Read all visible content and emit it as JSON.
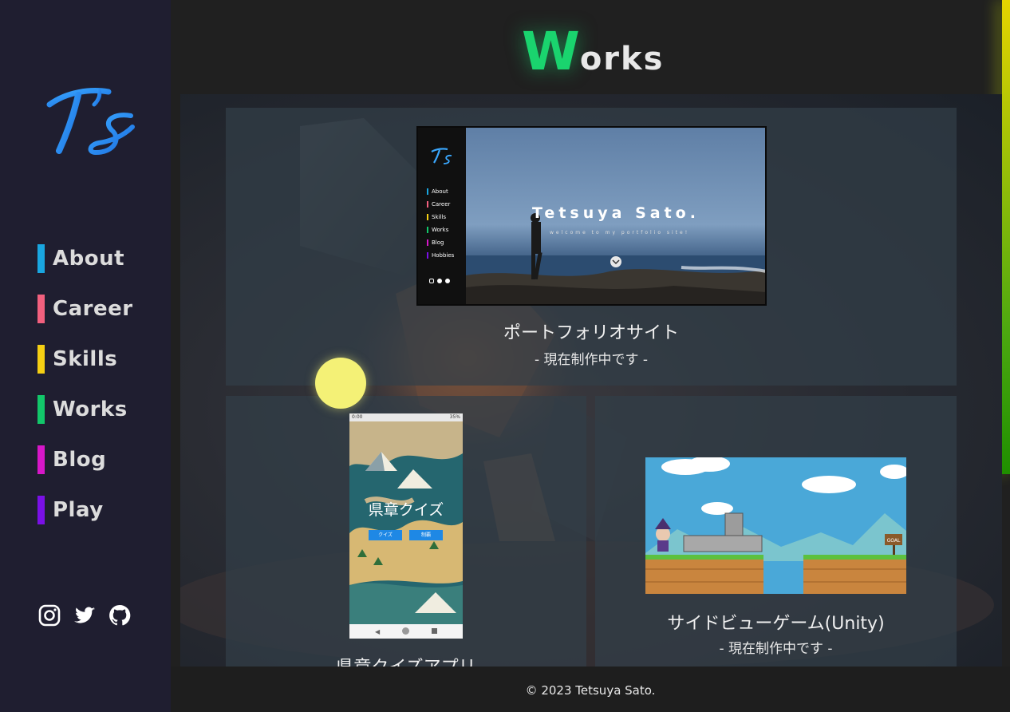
{
  "sidebar": {
    "nav": [
      {
        "label": "About",
        "color": "#19a6e0"
      },
      {
        "label": "Career",
        "color": "#f2607e"
      },
      {
        "label": "Skills",
        "color": "#f5cf13"
      },
      {
        "label": "Works",
        "color": "#12c76a"
      },
      {
        "label": "Blog",
        "color": "#d717c9"
      },
      {
        "label": "Play",
        "color": "#7a10e6"
      }
    ],
    "social_icons": [
      "instagram-icon",
      "twitter-icon",
      "github-icon"
    ]
  },
  "header": {
    "title_first": "W",
    "title_rest": "orks"
  },
  "works": [
    {
      "title": "ポートフォリオサイト",
      "subtitle": "- 現在制作中です -",
      "thumbnail": {
        "nav": [
          "About",
          "Career",
          "Skills",
          "Works",
          "Blog",
          "Hobbies"
        ],
        "hero_title": "Tetsuya Sato.",
        "hero_subtitle": "welcome to my portfolio site!"
      }
    },
    {
      "title": "県章クイズアプリ",
      "thumbnail": {
        "status_time": "0:00",
        "battery": "35%",
        "app_title": "県章クイズ",
        "buttons": [
          "クイズ",
          "制覇"
        ]
      }
    },
    {
      "title": "サイドビューゲーム(Unity)",
      "subtitle": "- 現在制作中です -",
      "thumbnail": {
        "goal_sign": "GOAL"
      }
    }
  ],
  "footer": {
    "copyright": "© 2023 Tetsuya Sato."
  },
  "colors": {
    "accent_green": "#1ad46e",
    "sidebar_bg": "#1f1e30",
    "page_bg": "#202020"
  }
}
